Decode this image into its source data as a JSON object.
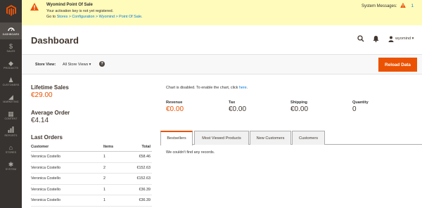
{
  "sidebar": {
    "logo_icon": "magento-logo-icon",
    "items": [
      {
        "label": "DASHBOARD",
        "icon": "dashboard-icon",
        "glyph": "◉",
        "active": true
      },
      {
        "label": "SALES",
        "icon": "dollar-icon",
        "glyph": "$",
        "active": false
      },
      {
        "label": "PRODUCTS",
        "icon": "cube-icon",
        "glyph": "◆",
        "active": false
      },
      {
        "label": "CUSTOMERS",
        "icon": "person-icon",
        "glyph": "♟",
        "active": false
      },
      {
        "label": "MARKETING",
        "icon": "megaphone-icon",
        "glyph": "◢",
        "active": false
      },
      {
        "label": "CONTENT",
        "icon": "content-icon",
        "glyph": "▦",
        "active": false
      },
      {
        "label": "REPORTS",
        "icon": "bar-chart-icon",
        "glyph": "▮",
        "active": false
      },
      {
        "label": "STORES",
        "icon": "store-icon",
        "glyph": "⌂",
        "active": false
      },
      {
        "label": "SYSTEM",
        "icon": "gear-icon",
        "glyph": "✱",
        "active": false
      }
    ]
  },
  "notice": {
    "title": "Wyomind Point Of Sale",
    "message": "Your activation key is not yet registered.",
    "path_prefix": "Go to ",
    "path_link": "Stores > Configuration > Wyomind > Point Of Sale",
    "path_suffix": ".",
    "system_messages_label": "System Messages:",
    "system_messages_count": "1"
  },
  "header": {
    "title": "Dashboard",
    "user": "wyomind"
  },
  "store_bar": {
    "label": "Store View:",
    "selected": "All Store Views",
    "reload_label": "Reload Data"
  },
  "stats": {
    "lifetime_label": "Lifetime Sales",
    "lifetime_value": "€29.00",
    "average_label": "Average Order",
    "average_value": "€4.14"
  },
  "orders": {
    "title": "Last Orders",
    "columns": [
      "Customer",
      "Items",
      "Total"
    ],
    "rows": [
      {
        "customer": "Veronica Costello",
        "items": "1",
        "total": "€58.46"
      },
      {
        "customer": "Veronica Costello",
        "items": "2",
        "total": "€152.63"
      },
      {
        "customer": "Veronica Costello",
        "items": "2",
        "total": "€152.63"
      },
      {
        "customer": "Veronica Costello",
        "items": "1",
        "total": "€36.39"
      },
      {
        "customer": "Veronica Costello",
        "items": "1",
        "total": "€36.39"
      }
    ]
  },
  "chart": {
    "message": "Chart is disabled. To enable the chart, click ",
    "link": "here",
    "message_end": "."
  },
  "totals": [
    {
      "label": "Revenue",
      "value": "€0.00",
      "accent": true
    },
    {
      "label": "Tax",
      "value": "€0.00",
      "accent": false
    },
    {
      "label": "Shipping",
      "value": "€0.00",
      "accent": false
    },
    {
      "label": "Quantity",
      "value": "0",
      "accent": false
    }
  ],
  "tabs": [
    {
      "label": "Bestsellers",
      "active": true
    },
    {
      "label": "Most Viewed Products",
      "active": false
    },
    {
      "label": "New Customers",
      "active": false
    },
    {
      "label": "Customers",
      "active": false
    }
  ],
  "tab_content": {
    "empty_message": "We couldn't find any records."
  },
  "colors": {
    "accent": "#eb5202",
    "sidebar": "#373330",
    "notice": "#fffbbb",
    "link": "#007bdb"
  }
}
